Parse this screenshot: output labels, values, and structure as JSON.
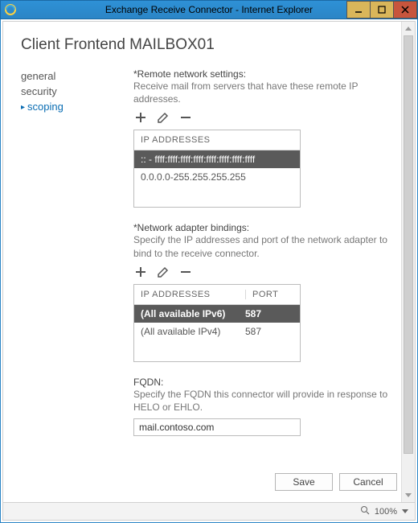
{
  "window": {
    "title": "Exchange Receive Connector - Internet Explorer"
  },
  "page": {
    "heading": "Client Frontend MAILBOX01"
  },
  "nav": {
    "items": [
      {
        "label": "general",
        "active": false
      },
      {
        "label": "security",
        "active": false
      },
      {
        "label": "scoping",
        "active": true
      }
    ]
  },
  "remote": {
    "label": "*Remote network settings:",
    "help": "Receive mail from servers that have these remote IP addresses.",
    "header_ip": "IP ADDRESSES",
    "rows": [
      {
        "ip": ":: - ffff:ffff:ffff:ffff:ffff:ffff:ffff:ffff",
        "selected": true
      },
      {
        "ip": "0.0.0.0-255.255.255.255",
        "selected": false
      }
    ]
  },
  "bindings": {
    "label": "*Network adapter bindings:",
    "help": "Specify the IP addresses and port of the network adapter to bind to the receive connector.",
    "header_ip": "IP ADDRESSES",
    "header_port": "PORT",
    "rows": [
      {
        "ip": "(All available IPv6)",
        "port": "587",
        "selected": true
      },
      {
        "ip": "(All available IPv4)",
        "port": "587",
        "selected": false
      }
    ]
  },
  "fqdn": {
    "label": "FQDN:",
    "help": "Specify the FQDN this connector will provide in response to HELO or EHLO.",
    "value": "mail.contoso.com"
  },
  "buttons": {
    "save": "Save",
    "cancel": "Cancel"
  },
  "status": {
    "zoom": "100%"
  }
}
